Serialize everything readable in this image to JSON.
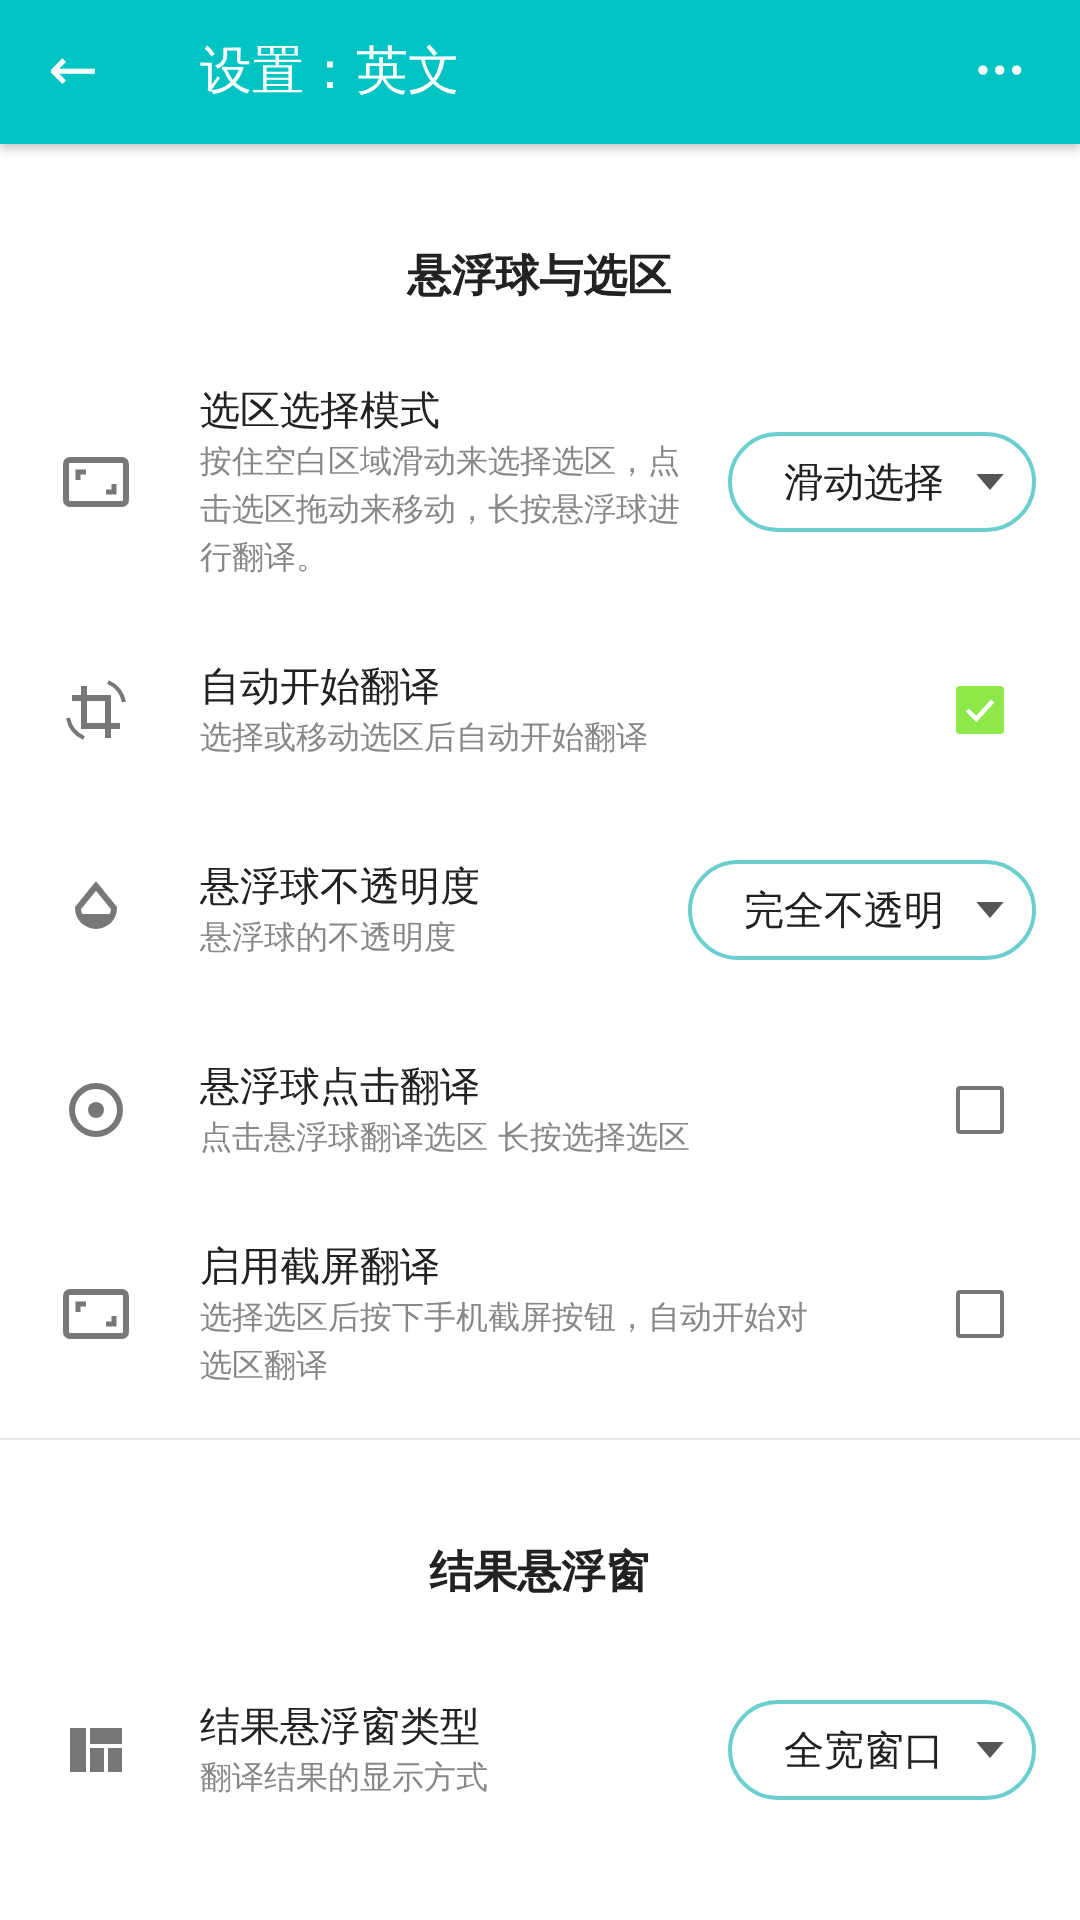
{
  "app_bar": {
    "back": "←",
    "title": "设置：英文",
    "more": "•••"
  },
  "sections": [
    {
      "title": "悬浮球与选区",
      "items": [
        {
          "kind": "dropdown",
          "label": "选区选择模式",
          "description": "按住空白区域滑动来选择选区，点击选区拖动来移动，长按悬浮球进行翻译。",
          "value": "滑动选择"
        },
        {
          "kind": "checkbox",
          "label": "自动开始翻译",
          "description": "选择或移动选区后自动开始翻译",
          "checked": true
        },
        {
          "kind": "dropdown",
          "label": "悬浮球不透明度",
          "description": "悬浮球的不透明度",
          "value": "完全不透明"
        },
        {
          "kind": "checkbox",
          "label": "悬浮球点击翻译",
          "description": "点击悬浮球翻译选区 长按选择选区",
          "checked": false
        },
        {
          "kind": "checkbox",
          "label": "启用截屏翻译",
          "description": "选择选区后按下手机截屏按钮，自动开始对选区翻译",
          "checked": false
        }
      ]
    },
    {
      "title": "结果悬浮窗",
      "items": [
        {
          "kind": "dropdown",
          "label": "结果悬浮窗类型",
          "description": "翻译结果的显示方式",
          "value": "全宽窗口"
        }
      ]
    }
  ]
}
